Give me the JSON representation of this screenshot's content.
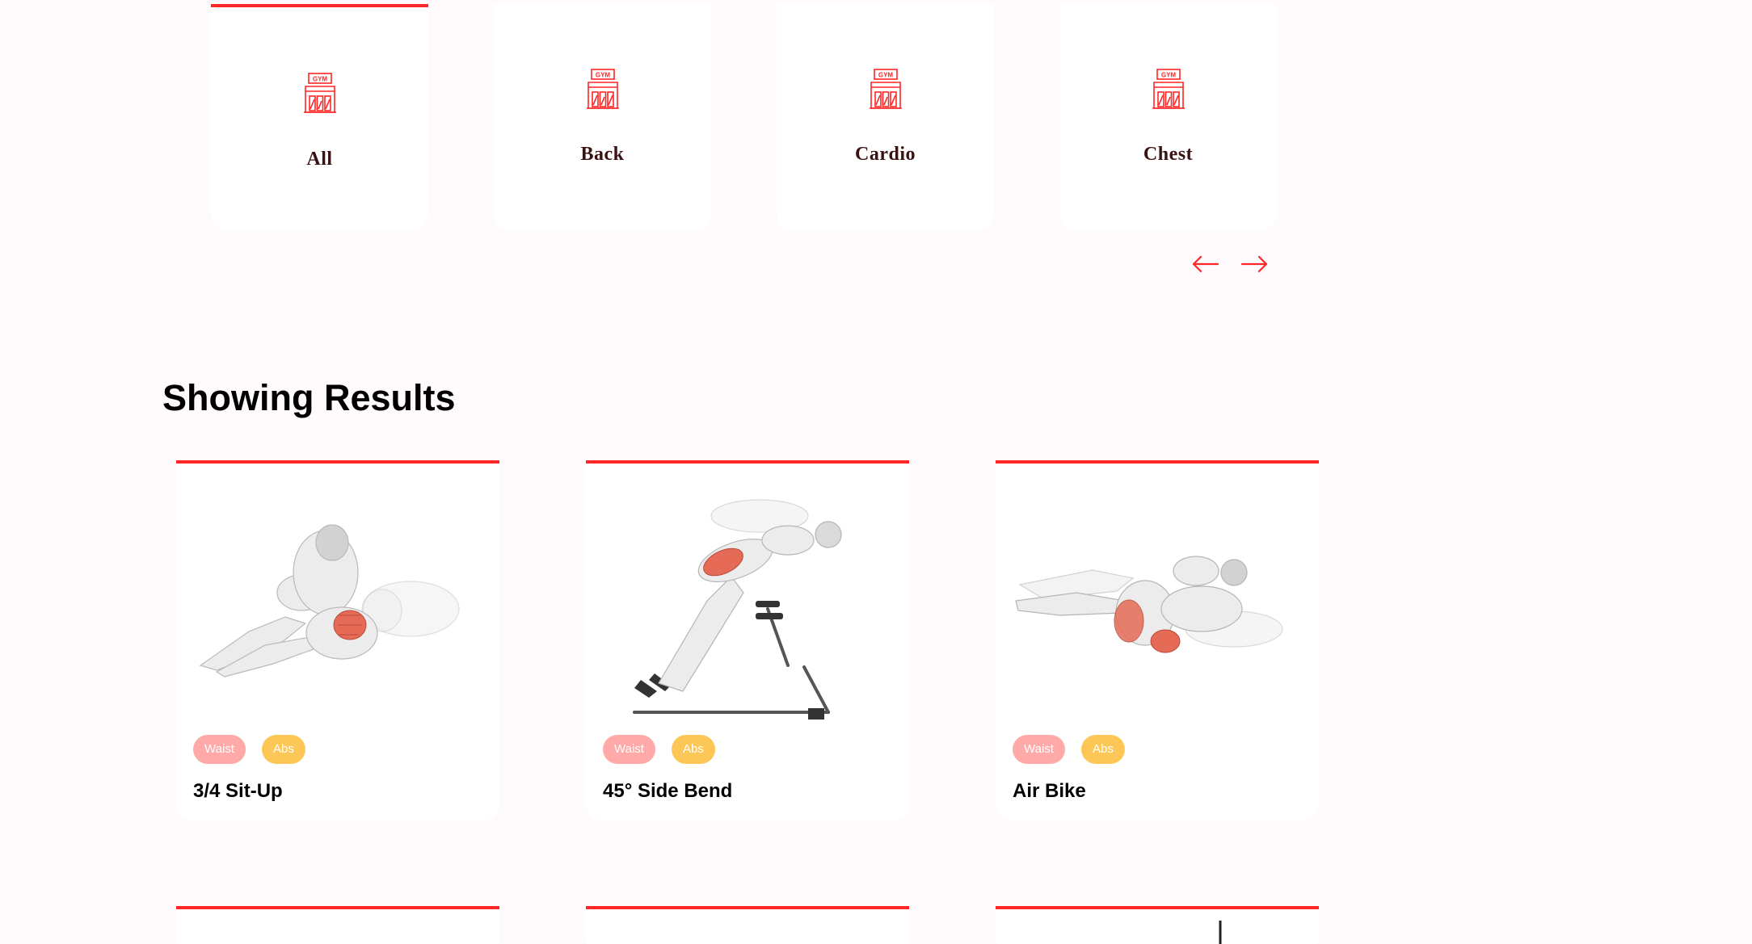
{
  "categories": {
    "icon": "gym-icon",
    "items": [
      {
        "label": "All",
        "active": true
      },
      {
        "label": "Back",
        "active": false
      },
      {
        "label": "Cardio",
        "active": false
      },
      {
        "label": "Chest",
        "active": false
      }
    ]
  },
  "scroll": {
    "prev_icon": "left-arrow-icon",
    "next_icon": "right-arrow-icon"
  },
  "results": {
    "title": "Showing Results",
    "exercises": [
      {
        "name": "3/4 Sit-Up",
        "body_part": "Waist",
        "target": "Abs",
        "image": "sit-up-illustration"
      },
      {
        "name": "45° Side Bend",
        "body_part": "Waist",
        "target": "Abs",
        "image": "side-bend-illustration"
      },
      {
        "name": "Air Bike",
        "body_part": "Waist",
        "target": "Abs",
        "image": "air-bike-illustration"
      }
    ]
  },
  "colors": {
    "accent": "#ff2625",
    "body_chip": "#ffa9a9",
    "target_chip": "#fcc757",
    "background": "#fffafb",
    "category_text": "#3a1212"
  }
}
